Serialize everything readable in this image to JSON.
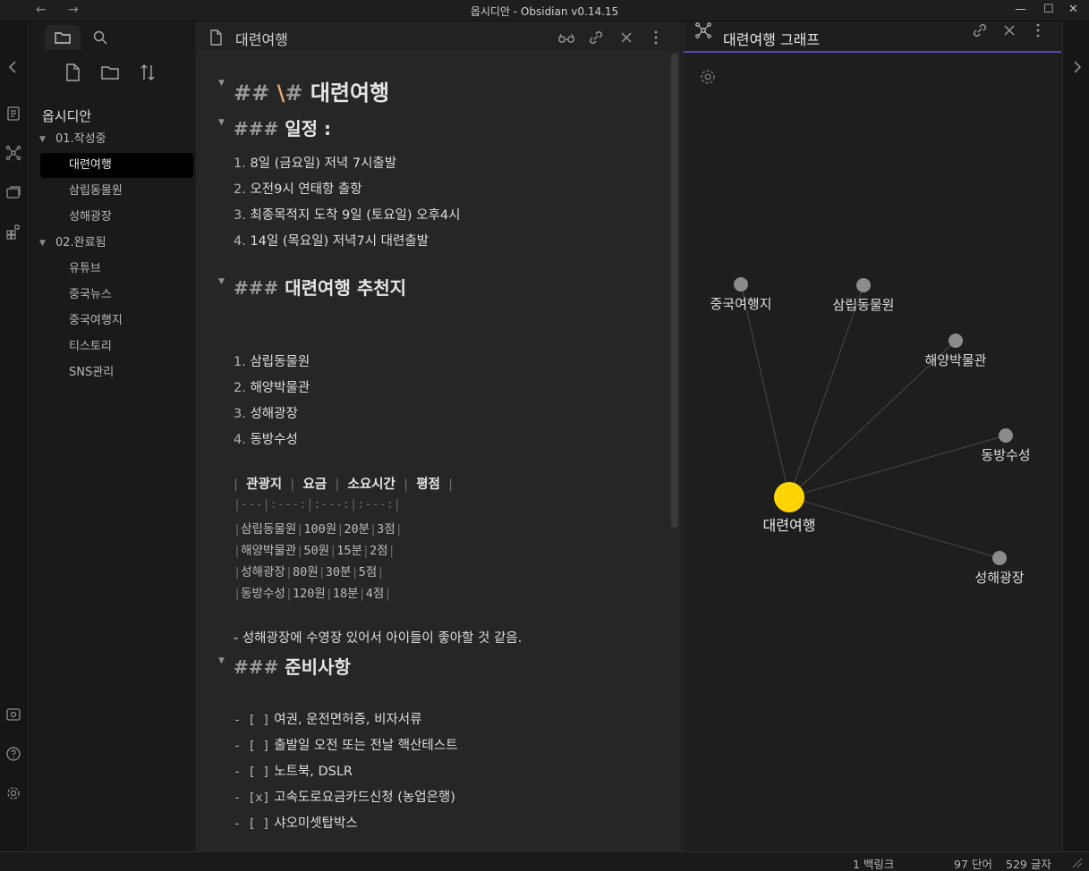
{
  "window": {
    "title": "옵시디안 - Obsidian v0.14.15",
    "back_glyph": "←",
    "forward_glyph": "→",
    "minimize_glyph": "—",
    "maximize_glyph": "☐",
    "close_glyph": "✕"
  },
  "sidebar": {
    "vault_name": "옵시디안",
    "tree": [
      {
        "type": "folder",
        "label": "01.작성중",
        "expanded": true
      },
      {
        "type": "file",
        "label": "대련여행",
        "active": true
      },
      {
        "type": "file",
        "label": "삼립동물원"
      },
      {
        "type": "file",
        "label": "성해광장"
      },
      {
        "type": "folder",
        "label": "02.완료됨",
        "expanded": true
      },
      {
        "type": "file",
        "label": "유튜브"
      },
      {
        "type": "file",
        "label": "중국뉴스"
      },
      {
        "type": "file",
        "label": "중국여행지"
      },
      {
        "type": "file",
        "label": "티스토리"
      },
      {
        "type": "file",
        "label": "SNS관리"
      }
    ]
  },
  "editor": {
    "tab_title": "대련여행",
    "h1": {
      "marks": "##",
      "escape": "\\#",
      "text": "대련여행"
    },
    "sched_heading": {
      "marks": "###",
      "text": "일정 :"
    },
    "schedule": [
      {
        "num": "1.",
        "text": "8일 (금요일) 저녁 7시출발"
      },
      {
        "num": "2.",
        "text": "오전9시 연태항 출항"
      },
      {
        "num": "3.",
        "text": "최종목적지 도착 9일 (토요일) 오후4시"
      },
      {
        "num": "4.",
        "text": "14일 (목요일) 저녁7시 대련출발"
      }
    ],
    "rec_heading": {
      "marks": "###",
      "text": "대련여행 추천지"
    },
    "recommend": [
      {
        "num": "1.",
        "text": "삼립동물원"
      },
      {
        "num": "2.",
        "text": "해양박물관"
      },
      {
        "num": "3.",
        "text": "성해광장"
      },
      {
        "num": "4.",
        "text": "동방수성"
      }
    ],
    "table": {
      "headers": [
        "관광지",
        "요금",
        "소요시간",
        "평점"
      ],
      "separator": "|---|:---:|:---:|:---:|",
      "rows": [
        [
          "삼립동물원",
          "100원",
          "20분",
          "3점"
        ],
        [
          "해양박물관",
          "50원",
          "15분",
          "2점"
        ],
        [
          "성해광장",
          "80원",
          "30분",
          "5점"
        ],
        [
          "동방수성",
          "120원",
          "18분",
          "4점"
        ]
      ]
    },
    "note": "- 성해광장에 수영장 있어서 아이들이 좋아할 것 같음.",
    "prep_heading": {
      "marks": "###",
      "text": "준비사항"
    },
    "checklist": [
      {
        "box": "- [ ]",
        "text": "여권, 운전면허증, 비자서류"
      },
      {
        "box": "- [ ]",
        "text": "출발일 오전 또는 전날 핵산테스트"
      },
      {
        "box": "- [ ]",
        "text": "노트북, DSLR"
      },
      {
        "box": "- [x]",
        "text": "고속도로요금카드신청 (농업은행)"
      },
      {
        "box": "- [ ]",
        "text": "샤오미셋탑박스"
      }
    ],
    "hr": "---"
  },
  "graph": {
    "tab_title": "대련여행 그래프",
    "center": {
      "label": "대련여행"
    },
    "nodes": [
      {
        "label": "중국여행지"
      },
      {
        "label": "삼립동물원"
      },
      {
        "label": "해양박물관"
      },
      {
        "label": "동방수성"
      },
      {
        "label": "성해광장"
      }
    ],
    "colors": {
      "center": "#ffd400",
      "node": "#8b8b8b",
      "edge": "#4a4a4a",
      "accent": "#5a44b7"
    }
  },
  "status": {
    "backlinks": "1 백링크",
    "words": "97 단어",
    "chars": "529 글자"
  }
}
